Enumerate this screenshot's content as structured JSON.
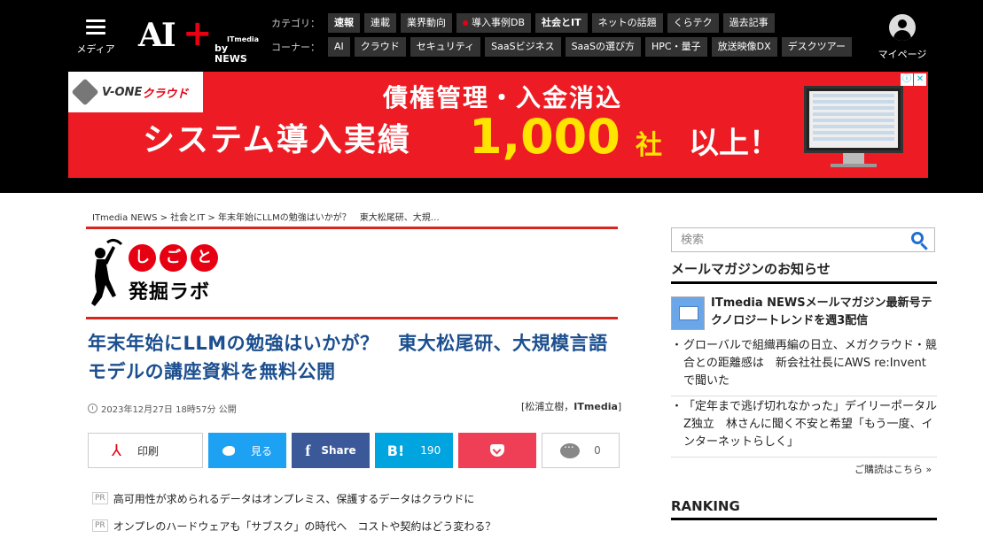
{
  "header": {
    "menu_label": "メディア",
    "logo_ai": "AI",
    "logo_plus": "+",
    "logo_itmedia": "ITmedia",
    "logo_by": "by NEWS",
    "category_label": "カテゴリ：",
    "corner_label": "コーナー：",
    "categories": [
      "速報",
      "連載",
      "業界動向",
      "導入事例DB",
      "社会とIT",
      "ネットの話題",
      "くらテク",
      "過去記事"
    ],
    "corners": [
      "AI",
      "クラウド",
      "セキュリティ",
      "SaaSビジネス",
      "SaaSの選び方",
      "HPC・量子",
      "放送映像DX",
      "デスクツアー"
    ],
    "mypage_label": "マイページ"
  },
  "ad": {
    "brand": "V-ONE",
    "brand_cloud": "クラウド",
    "line1": "債権管理・入金消込",
    "line2": "システム導入実績",
    "big": "1,000",
    "sha": "社",
    "ijou": "以上！",
    "info": "ⓘ",
    "close": "✕"
  },
  "breadcrumb": "ITmedia NEWS > 社会とIT > 年末年始にLLMの勉強はいかが？　東大松尾研、大規…",
  "corner_logo": {
    "chars": [
      "し",
      "ご",
      "と"
    ],
    "main": "発掘ラボ"
  },
  "article": {
    "title": "年末年始にLLMの勉強はいかが？　東大松尾研、大規模言語モデルの講座資料を無料公開",
    "date": "2023年12月27日 18時57分 公開",
    "author_prefix": "[松浦立樹，",
    "author_org": "ITmedia",
    "author_suffix": "]"
  },
  "share": {
    "print": "印刷",
    "twitter": "見る",
    "facebook": "Share",
    "hatena_icon": "B!",
    "hatena_count": "190",
    "comment_count": "0"
  },
  "pr": {
    "tag": "PR",
    "items": [
      "高可用性が求められるデータはオンプレミス、保護するデータはクラウドに",
      "オンプレのハードウェアも「サブスク」の時代へ　コストや契約はどう変わる？"
    ]
  },
  "sidebar": {
    "search_placeholder": "検索",
    "mail_title": "メールマガジンのお知らせ",
    "mail_main": "ITmedia NEWSメールマガジン最新号テクノロジートレンドを週3配信",
    "links": [
      "グローバルで組織再編の日立、メガクラウド・競合との距離感は　新会社社長にAWS re:Inventで聞いた",
      "「定年まで逃げ切れなかった」デイリーポータルZ独立　林さんに聞く不安と希望「もう一度、インターネットらしく」"
    ],
    "subscribe": "ご購読はこちら »",
    "ranking_title": "RANKING"
  },
  "colors": {
    "accent_red": "#d9251d",
    "title_blue": "#1c4f8f",
    "twitter": "#1da1f2",
    "facebook": "#3b5998",
    "hatena": "#00a4de",
    "pocket": "#ef3f56"
  }
}
